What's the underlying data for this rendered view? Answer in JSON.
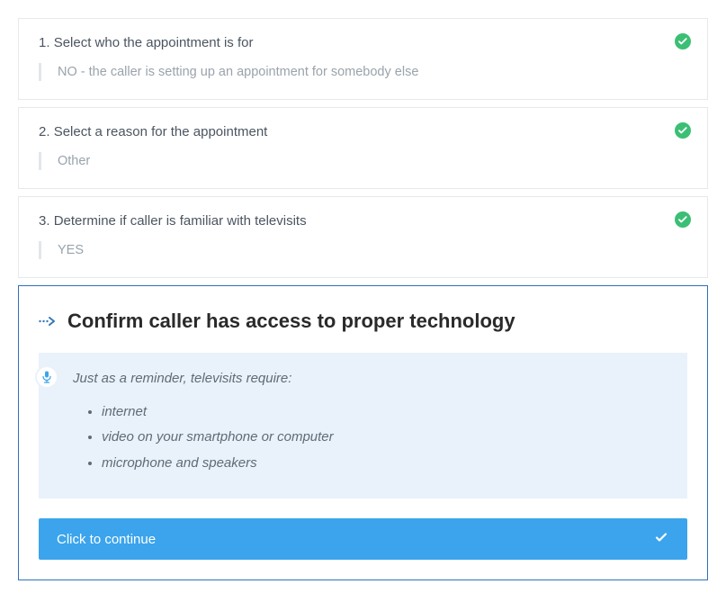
{
  "steps": [
    {
      "number": "1.",
      "title": "Select who the appointment is for",
      "answer": "NO - the caller is setting up an appointment for somebody else",
      "completed": true
    },
    {
      "number": "2.",
      "title": "Select a reason for the appointment",
      "answer": "Other",
      "completed": true
    },
    {
      "number": "3.",
      "title": "Determine if caller is familiar with televisits",
      "answer": "YES",
      "completed": true
    }
  ],
  "active_step": {
    "title": "Confirm caller has access to proper technology",
    "reminder_intro": "Just as a reminder, televisits require:",
    "requirements": [
      "internet",
      "video on your smartphone or computer",
      "microphone and speakers"
    ],
    "continue_label": "Click to continue"
  },
  "colors": {
    "accent": "#3ba4ec",
    "success": "#3bbf74",
    "border_active": "#2f72b9",
    "info_bg": "#e9f2fb"
  }
}
